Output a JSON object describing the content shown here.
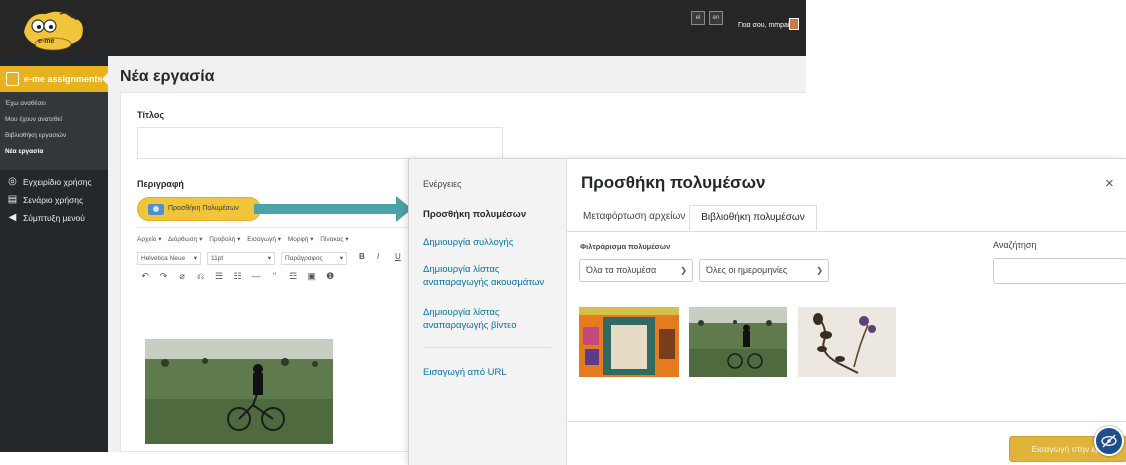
{
  "header": {
    "logo_text": "e-me",
    "lang_buttons": [
      "el",
      "en"
    ],
    "greeting": "Γεια σου, mmpaiiou"
  },
  "sidebar": {
    "active_section": "e-me assignments",
    "submenu": [
      "Έχω αναθέσει",
      "Μου έχουν ανατεθεί",
      "Βιβλιοθήκη εργασιών",
      "Νέα εργασία"
    ],
    "items": [
      {
        "icon": "help-circle-icon",
        "label": "Εγχειρίδιο χρήσης"
      },
      {
        "icon": "document-icon",
        "label": "Σενάριο χρήσης"
      },
      {
        "icon": "collapse-icon",
        "label": "Σύμπτυξη μενού"
      }
    ]
  },
  "page": {
    "title": "Νέα εργασία",
    "title_label": "Τίτλος",
    "description_label": "Περιγραφή",
    "add_media_button": "Προσθήκη Πολυμέσων"
  },
  "editor": {
    "menus": [
      "Αρχείο ▾",
      "Διόρθωση ▾",
      "Προβολή ▾",
      "Εισαγωγή ▾",
      "Μορφή ▾",
      "Πίνακας ▾"
    ],
    "font_family": "Helvetica Neue",
    "font_size": "11pt",
    "paragraph": "Παράγραφος",
    "format_icons": [
      "B",
      "I",
      "U"
    ],
    "toolbar_icons": [
      "↶",
      "↷",
      "⌀",
      "⎌",
      "☰",
      "☷",
      "—",
      "“",
      "☲",
      "▣",
      "❶"
    ]
  },
  "modal": {
    "actions_label": "Ενέργειες",
    "menu": [
      "Προσθήκη πολυμέσων",
      "Δημιουργία συλλογής",
      "Δημιουργία λίστας αναπαραγωγής ακουσμάτων",
      "Δημιουργία λίστας αναπαραγωγής βίντεο",
      "Εισαγωγή από URL"
    ],
    "title": "Προσθήκη πολυμέσων",
    "close": "×",
    "tabs": [
      "Μεταφόρτωση αρχείων",
      "Βιβλιοθήκη πολυμέσων"
    ],
    "active_tab": "Βιβλιοθήκη πολυμέσων",
    "filter_label": "Φιλτράρισμα πολυμέσων",
    "filter_type": "Όλα τα πολυμέσα",
    "filter_date": "Όλες οι ημερομηνίες",
    "search_label": "Αναζήτηση",
    "search_value": "",
    "insert_button": "Εισαγωγή στην εργ"
  },
  "colors": {
    "accent_yellow": "#f0c53b",
    "sidebar_dark": "#23282d",
    "topbar": "#262626",
    "link_blue": "#0073aa",
    "arrow_teal": "#4aa3a8"
  }
}
